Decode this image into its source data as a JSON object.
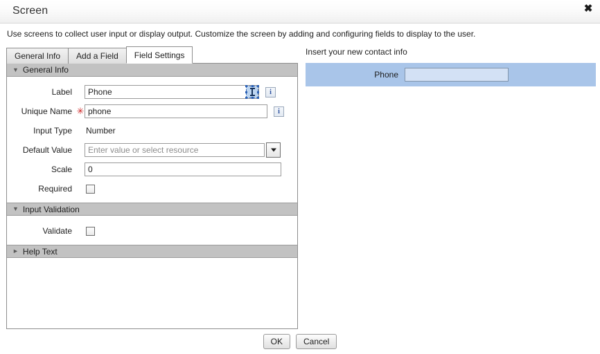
{
  "window": {
    "title": "Screen",
    "close_label": "✖",
    "description": "Use screens to collect user input or display output. Customize the screen by adding and configuring fields to display to the user."
  },
  "tabs": [
    {
      "label": "General Info",
      "active": false
    },
    {
      "label": "Add a Field",
      "active": false
    },
    {
      "label": "Field Settings",
      "active": true
    }
  ],
  "sections": {
    "general_info": {
      "header": "General Info",
      "twisty": "▼",
      "expanded": true,
      "fields": {
        "label": {
          "label": "Label",
          "value": "Phone",
          "required": false,
          "info": "i"
        },
        "unique_name": {
          "label": "Unique Name",
          "value": "phone",
          "required": true,
          "required_marker": "✳",
          "info": "i"
        },
        "input_type": {
          "label": "Input Type",
          "value": "Number"
        },
        "default_value": {
          "label": "Default Value",
          "value": "",
          "placeholder": "Enter value or select resource",
          "dropdown_icon": "chevron-down"
        },
        "scale": {
          "label": "Scale",
          "value": "0"
        },
        "required_cb": {
          "label": "Required",
          "checked": false
        }
      }
    },
    "input_validation": {
      "header": "Input Validation",
      "twisty": "▼",
      "expanded": true,
      "fields": {
        "validate": {
          "label": "Validate",
          "checked": false
        }
      }
    },
    "help_text": {
      "header": "Help Text",
      "twisty": "►",
      "expanded": false
    }
  },
  "preview": {
    "title": "Insert your new contact info",
    "field_label": "Phone",
    "field_value": "",
    "row_bg": "#a9c5e9",
    "input_bg": "#d3e1f5"
  },
  "footer": {
    "ok_label": "OK",
    "cancel_label": "Cancel"
  },
  "colors": {
    "section_header_bg": "#c2c2c2",
    "required_star": "#cc2222",
    "info_icon": "#2b4f9e"
  }
}
